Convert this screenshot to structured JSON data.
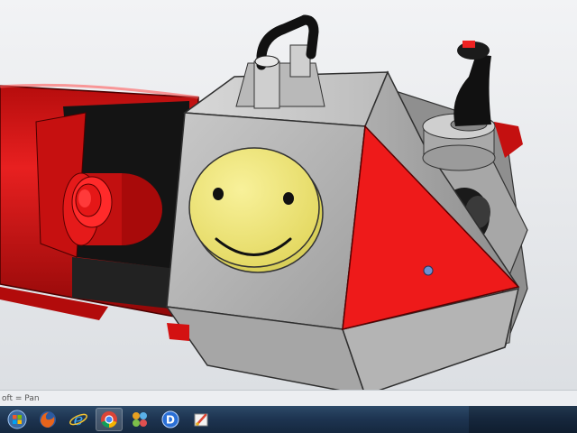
{
  "status_bar": {
    "text": "oft = Pan"
  },
  "taskbar": {
    "items": [
      {
        "name": "windows-start-icon",
        "active": false
      },
      {
        "name": "firefox-icon",
        "active": false
      },
      {
        "name": "internet-explorer-icon",
        "active": false
      },
      {
        "name": "chrome-icon",
        "active": true
      },
      {
        "name": "media-player-icon",
        "active": false
      },
      {
        "name": "cad-app-icon",
        "active": false
      },
      {
        "name": "paint-icon",
        "active": false
      }
    ]
  },
  "colors": {
    "body_red": "#e41717",
    "cube_gray": "#bdbdbd",
    "smiley_yellow": "#f2ea78",
    "taskbar_blue": "#1e3552"
  }
}
